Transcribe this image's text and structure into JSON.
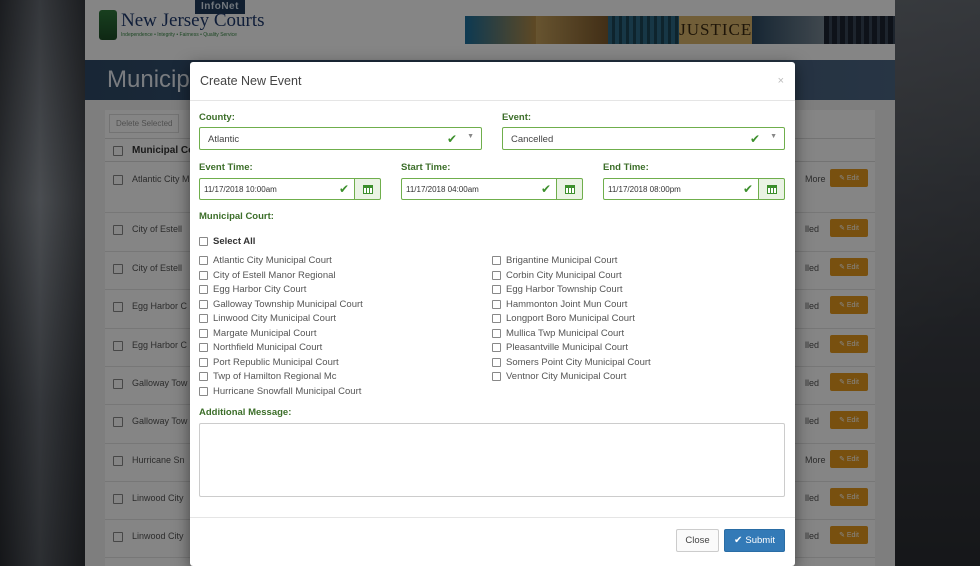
{
  "site": {
    "infonet": "InfoNet",
    "logo_name": "New Jersey Courts",
    "logo_tagline": "Independence • Integrity • Fairness • Quality Service",
    "banner_word": "JUSTICE",
    "page_title": "Municipal",
    "delete_selected": "Delete Selected",
    "column_header": "Municipal Co",
    "edit_label": "✎ Edit",
    "rows": [
      {
        "name": "Atlantic City M",
        "status": "More"
      },
      {
        "name": "City of Estell",
        "status": "lled"
      },
      {
        "name": "City of Estell",
        "status": "lled"
      },
      {
        "name": "Egg Harbor C",
        "status": "lled"
      },
      {
        "name": "Egg Harbor C",
        "status": "lled"
      },
      {
        "name": "Galloway Tow",
        "status": "lled"
      },
      {
        "name": "Galloway Tow",
        "status": "lled"
      },
      {
        "name": "Hurricane Sn",
        "status": "More"
      },
      {
        "name": "Linwood City",
        "status": "lled"
      },
      {
        "name": "Linwood City",
        "status": "lled"
      }
    ]
  },
  "modal": {
    "title": "Create New Event",
    "close_x": "×",
    "county": {
      "label": "County:",
      "value": "Atlantic"
    },
    "event": {
      "label": "Event:",
      "value": "Cancelled"
    },
    "event_time": {
      "label": "Event Time:",
      "value": "11/17/2018 10:00am"
    },
    "start_time": {
      "label": "Start Time:",
      "value": "11/17/2018 04:00am"
    },
    "end_time": {
      "label": "End Time:",
      "value": "11/17/2018 08:00pm"
    },
    "courts_label": "Municipal Court:",
    "select_all": "Select All",
    "courts_left": [
      "Atlantic City Municipal Court",
      "City of Estell Manor Regional",
      "Egg Harbor City Court",
      "Galloway Township Municipal Court",
      "Linwood City Municipal Court",
      "Margate Municipal Court",
      "Northfield Municipal Court",
      "Port Republic Municipal Court",
      "Twp of Hamilton Regional Mc",
      "Hurricane Snowfall Municipal Court"
    ],
    "courts_right": [
      "Brigantine Municipal Court",
      "Corbin City Municipal Court",
      "Egg Harbor Township Court",
      "Hammonton Joint Mun Court",
      "Longport Boro Municipal Court",
      "Mullica Twp Municipal Court",
      "Pleasantville Municipal Court",
      "Somers Point City Municipal Court",
      "Ventnor City Municipal Court"
    ],
    "message_label": "Additional Message:",
    "close_button": "Close",
    "submit_button": "Submit"
  },
  "colors": {
    "label_green": "#3c6e29",
    "valid_border": "#6fae4c",
    "submit_blue": "#337ab7",
    "edit_orange": "#e69a1e"
  }
}
